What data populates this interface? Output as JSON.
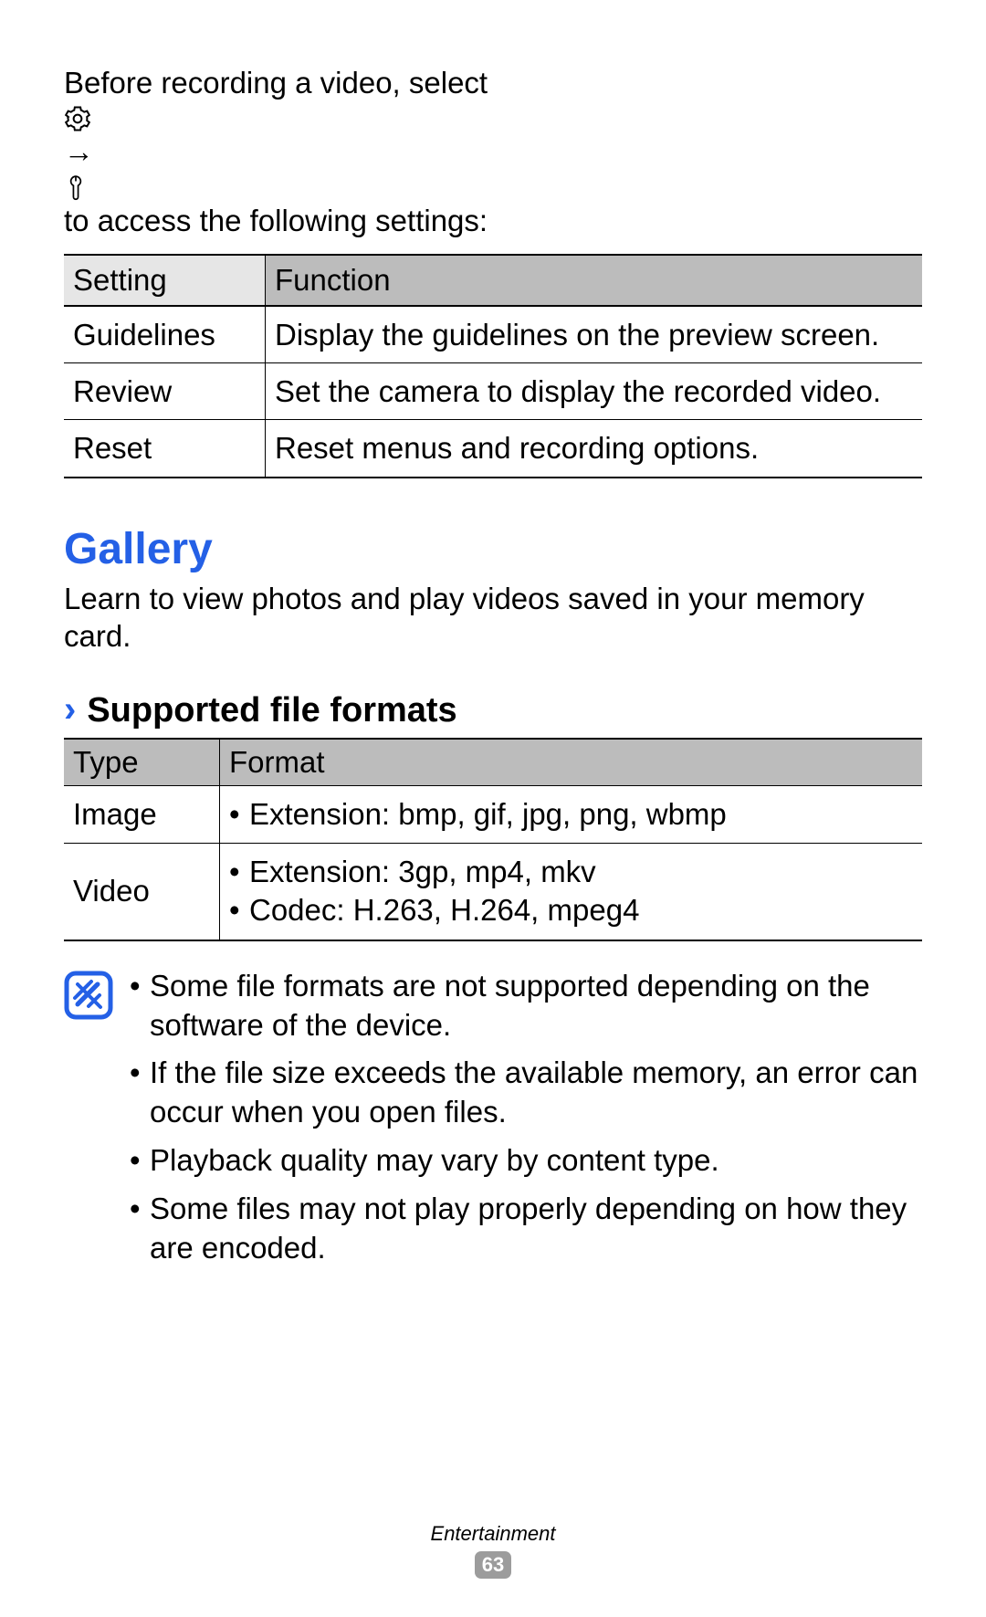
{
  "intro": {
    "before": "Before recording a video, select ",
    "arrow": " → ",
    "after": " to access the following settings:"
  },
  "settings_table": {
    "headers": {
      "col1": "Setting",
      "col2": "Function"
    },
    "rows": [
      {
        "setting": "Guidelines",
        "function": "Display the guidelines on the preview screen."
      },
      {
        "setting": "Review",
        "function": "Set the camera to display the recorded video."
      },
      {
        "setting": "Reset",
        "function": "Reset menus and recording options."
      }
    ]
  },
  "gallery": {
    "title": "Gallery",
    "description": "Learn to view photos and play videos saved in your memory card."
  },
  "supported": {
    "chevron": "›",
    "title": "Supported file formats",
    "headers": {
      "col1": "Type",
      "col2": "Format"
    },
    "rows": {
      "image": {
        "type": "Image",
        "line1": "Extension: bmp, gif, jpg, png, wbmp"
      },
      "video": {
        "type": "Video",
        "line1": "Extension: 3gp, mp4, mkv",
        "line2": "Codec: H.263, H.264, mpeg4"
      }
    }
  },
  "notes": [
    "Some file formats are not supported depending on the software of the device.",
    "If the file size exceeds the available memory, an error can occur when you open files.",
    "Playback quality may vary by content type.",
    "Some files may not play properly depending on how they are encoded."
  ],
  "bullet": "•",
  "footer": {
    "section": "Entertainment",
    "page": "63"
  }
}
